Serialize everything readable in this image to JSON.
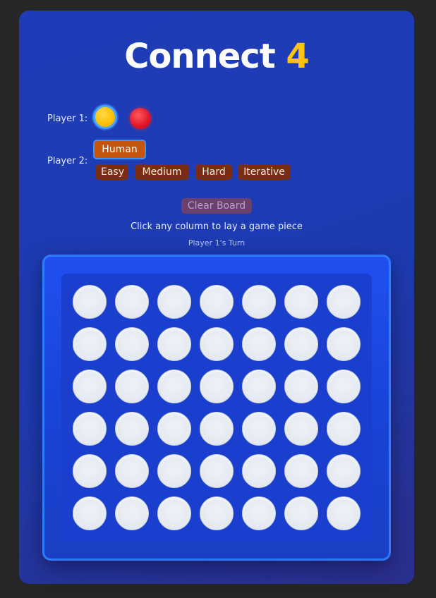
{
  "title": {
    "main": "Connect",
    "accent": "4"
  },
  "players": {
    "player1_label": "Player 1:",
    "player2_label": "Player 2:",
    "player1_options": [
      {
        "color": "yellow",
        "hex": "#ffc20e",
        "selected": true
      },
      {
        "color": "red",
        "hex": "#e0142a",
        "selected": false
      }
    ],
    "player2_options": {
      "human": "Human",
      "easy": "Easy",
      "medium": "Medium",
      "hard": "Hard",
      "iterative": "Iterative"
    },
    "player2_selected": "Human"
  },
  "controls": {
    "clear_label": "Clear Board",
    "instructions": "Click any column to lay a game piece",
    "turn_status": "Player 1's Turn"
  },
  "board": {
    "columns": 7,
    "rows": 6,
    "cells": [
      [
        "empty",
        "empty",
        "empty",
        "empty",
        "empty",
        "empty",
        "empty"
      ],
      [
        "empty",
        "empty",
        "empty",
        "empty",
        "empty",
        "empty",
        "empty"
      ],
      [
        "empty",
        "empty",
        "empty",
        "empty",
        "empty",
        "empty",
        "empty"
      ],
      [
        "empty",
        "empty",
        "empty",
        "empty",
        "empty",
        "empty",
        "empty"
      ],
      [
        "empty",
        "empty",
        "empty",
        "empty",
        "empty",
        "empty",
        "empty"
      ],
      [
        "empty",
        "empty",
        "empty",
        "empty",
        "empty",
        "empty",
        "empty"
      ]
    ]
  },
  "colors": {
    "background": "#262626",
    "panel": "#1e3cb8",
    "accent_yellow": "#ffc20e",
    "board_border": "#2f7bff",
    "chip": "#7a2d12",
    "chip_selected": "#c4560e"
  }
}
